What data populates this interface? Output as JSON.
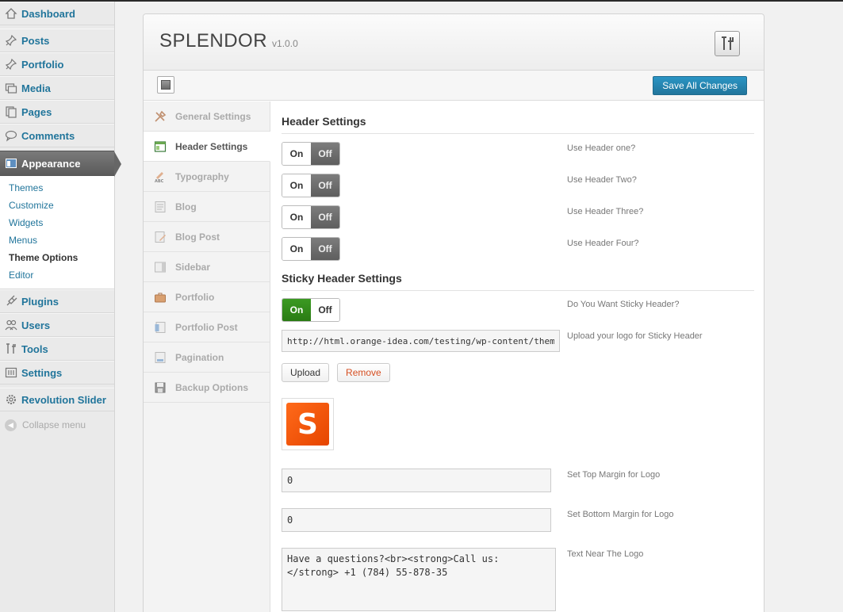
{
  "admin_menu": {
    "items": [
      {
        "label": "Dashboard",
        "icon": "dashboard-icon"
      },
      {
        "label": "Posts",
        "icon": "pin-icon"
      },
      {
        "label": "Portfolio",
        "icon": "pin-icon"
      },
      {
        "label": "Media",
        "icon": "media-icon"
      },
      {
        "label": "Pages",
        "icon": "pages-icon"
      },
      {
        "label": "Comments",
        "icon": "comment-icon"
      },
      {
        "label": "Appearance",
        "icon": "appearance-icon"
      },
      {
        "label": "Plugins",
        "icon": "plugin-icon"
      },
      {
        "label": "Users",
        "icon": "users-icon"
      },
      {
        "label": "Tools",
        "icon": "tools-icon"
      },
      {
        "label": "Settings",
        "icon": "settings-icon"
      },
      {
        "label": "Revolution Slider",
        "icon": "gear-icon"
      }
    ],
    "appearance_submenu": [
      "Themes",
      "Customize",
      "Widgets",
      "Menus",
      "Theme Options",
      "Editor"
    ],
    "collapse_label": "Collapse menu"
  },
  "panel": {
    "brand": "SPLENDOR",
    "version": "v1.0.0",
    "save_label": "Save All Changes"
  },
  "tabs": [
    "General Settings",
    "Header Settings",
    "Typography",
    "Blog",
    "Blog Post",
    "Sidebar",
    "Portfolio",
    "Portfolio Post",
    "Pagination",
    "Backup Options"
  ],
  "header_settings": {
    "title": "Header Settings",
    "toggle_on": "On",
    "toggle_off": "Off",
    "options": [
      {
        "label": "Use Header one?",
        "state": "off"
      },
      {
        "label": "Use Header Two?",
        "state": "off"
      },
      {
        "label": "Use Header Three?",
        "state": "off"
      },
      {
        "label": "Use Header Four?",
        "state": "off"
      }
    ]
  },
  "sticky_header": {
    "title": "Sticky Header Settings",
    "sticky_label": "Do You Want Sticky Header?",
    "sticky_state": "on",
    "logo_url_label": "Upload your logo for Sticky Header",
    "logo_url": "http://html.orange-idea.com/testing/wp-content/themes/splendor/images/logo-sticky.png",
    "upload_label": "Upload",
    "remove_label": "Remove",
    "logo_letter": "S",
    "top_margin_label": "Set Top Margin for Logo",
    "top_margin": "0",
    "bottom_margin_label": "Set Bottom Margin for Logo",
    "bottom_margin": "0",
    "text_near_logo_label": "Text Near The Logo",
    "text_near_logo": "Have a questions?<br><strong>Call us:</strong> +1 (784) 55-878-35"
  },
  "colors": {
    "accent_blue": "#21759b",
    "toggle_green": "#2a7b14",
    "logo_orange": "#ff5a00"
  }
}
